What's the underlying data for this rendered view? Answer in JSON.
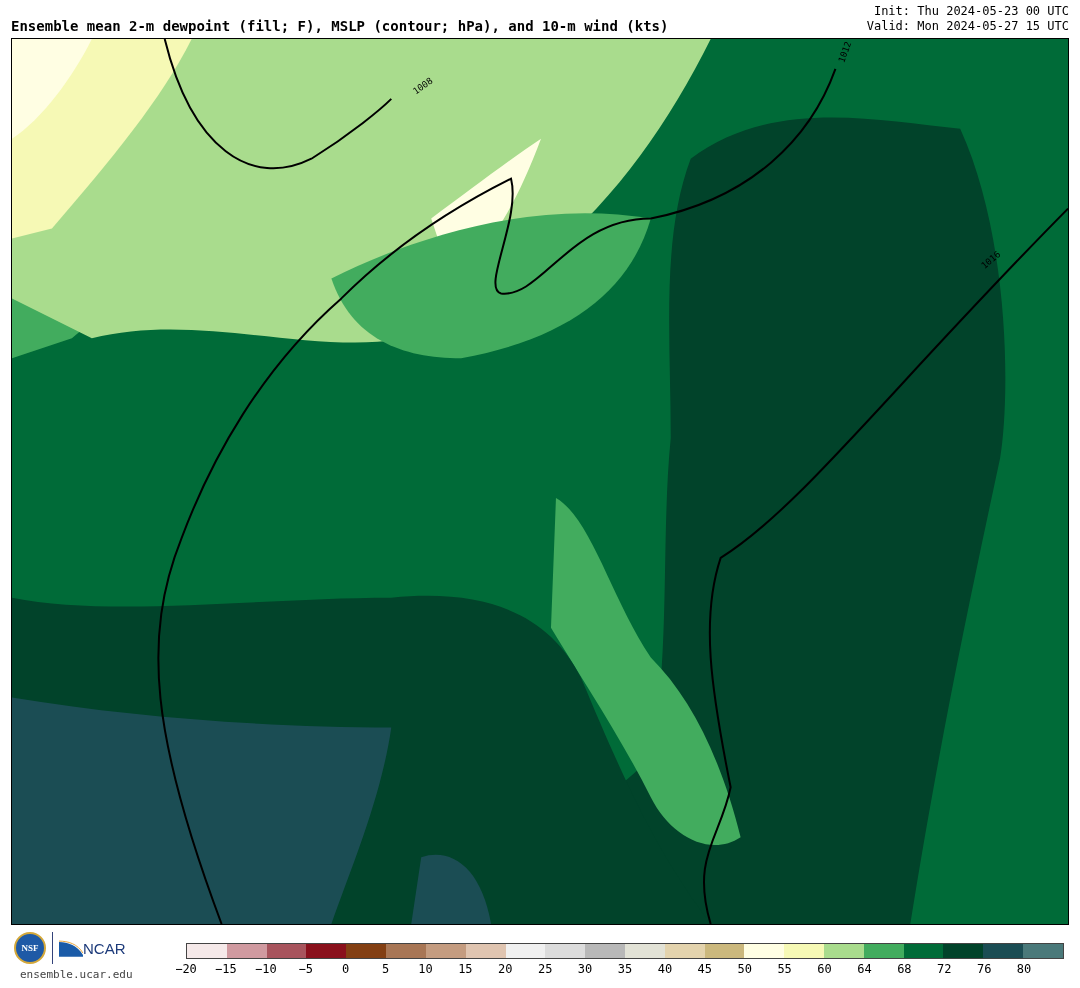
{
  "header": {
    "title": "Ensemble mean 2-m dewpoint (fill; F), MSLP (contour; hPa), and 10-m wind (kts)",
    "init": "Init: Thu 2024-05-23 00 UTC",
    "valid": "Valid: Mon 2024-05-27 15 UTC"
  },
  "map": {
    "contour_labels": [
      "1008",
      "1012",
      "1016"
    ]
  },
  "footer": {
    "logos": [
      "NSF",
      "NCAR"
    ],
    "url": "ensemble.ucar.edu"
  },
  "colorbar": {
    "bins": [
      {
        "color": "#f5e9e9"
      },
      {
        "color": "#d09aa0"
      },
      {
        "color": "#a8545d"
      },
      {
        "color": "#8a101c"
      },
      {
        "color": "#833f13"
      },
      {
        "color": "#a87655"
      },
      {
        "color": "#c49c80"
      },
      {
        "color": "#dfc4b0"
      },
      {
        "color": "#f0f0f0"
      },
      {
        "color": "#dcdcdc"
      },
      {
        "color": "#b8b8b8"
      },
      {
        "color": "#e2e2d6"
      },
      {
        "color": "#e3d3ad"
      },
      {
        "color": "#cbb87d"
      },
      {
        "color": "#fffee3"
      },
      {
        "color": "#f6f9b5"
      },
      {
        "color": "#a9dc8d"
      },
      {
        "color": "#42ac5e"
      },
      {
        "color": "#006b38"
      },
      {
        "color": "#01432a"
      },
      {
        "color": "#1b4d54"
      },
      {
        "color": "#4a797a"
      }
    ],
    "ticks": [
      "−20",
      "−15",
      "−10",
      "−5",
      "0",
      "5",
      "10",
      "15",
      "20",
      "25",
      "30",
      "35",
      "40",
      "45",
      "50",
      "55",
      "60",
      "64",
      "68",
      "72",
      "76",
      "80"
    ]
  }
}
